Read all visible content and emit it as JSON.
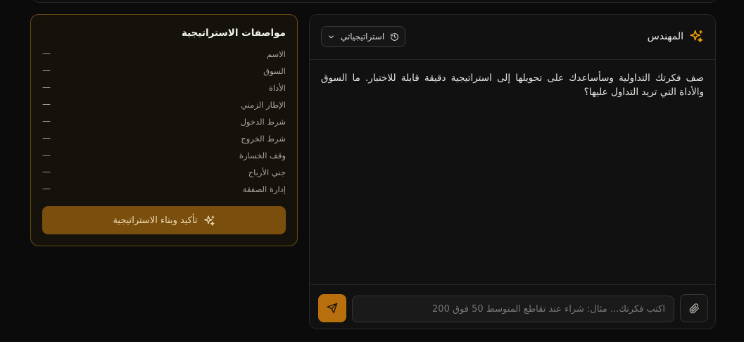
{
  "chat": {
    "title": "المهندس",
    "strategies_button": "استراتيجياتي",
    "assistant_message": "صف فكرتك التداولية وسأساعدك على تحويلها إلى استراتيجية دقيقة قابلة للاختبار. ما السوق والأداة التي تريد التداول عليها؟",
    "input_placeholder": "اكتب فكرتك... مثال: شراء عند تقاطع المتوسط 50 فوق 200"
  },
  "spec": {
    "title": "مواصفات الاستراتيجية",
    "rows": [
      {
        "label": "الاسم",
        "value": "—"
      },
      {
        "label": "السوق",
        "value": "—"
      },
      {
        "label": "الأداة",
        "value": "—"
      },
      {
        "label": "الإطار الزمني",
        "value": "—"
      },
      {
        "label": "شرط الدخول",
        "value": "—"
      },
      {
        "label": "شرط الخروج",
        "value": "—"
      },
      {
        "label": "وقف الخسارة",
        "value": "—"
      },
      {
        "label": "جني الأرباح",
        "value": "—"
      },
      {
        "label": "إدارة الصفقة",
        "value": "—"
      }
    ],
    "confirm_button": "تأكيد وبناء الاستراتيجية"
  },
  "colors": {
    "accent": "#f59e0b",
    "button": "#b8700f",
    "confirm": "#7a4e0c",
    "spec_border": "#6a4a10"
  },
  "icons": {
    "title": "sparkles-icon",
    "strategies": "history-icon",
    "dropdown": "chevron-down-icon",
    "send": "send-icon",
    "attach": "paperclip-icon",
    "confirm": "sparkles-icon"
  }
}
